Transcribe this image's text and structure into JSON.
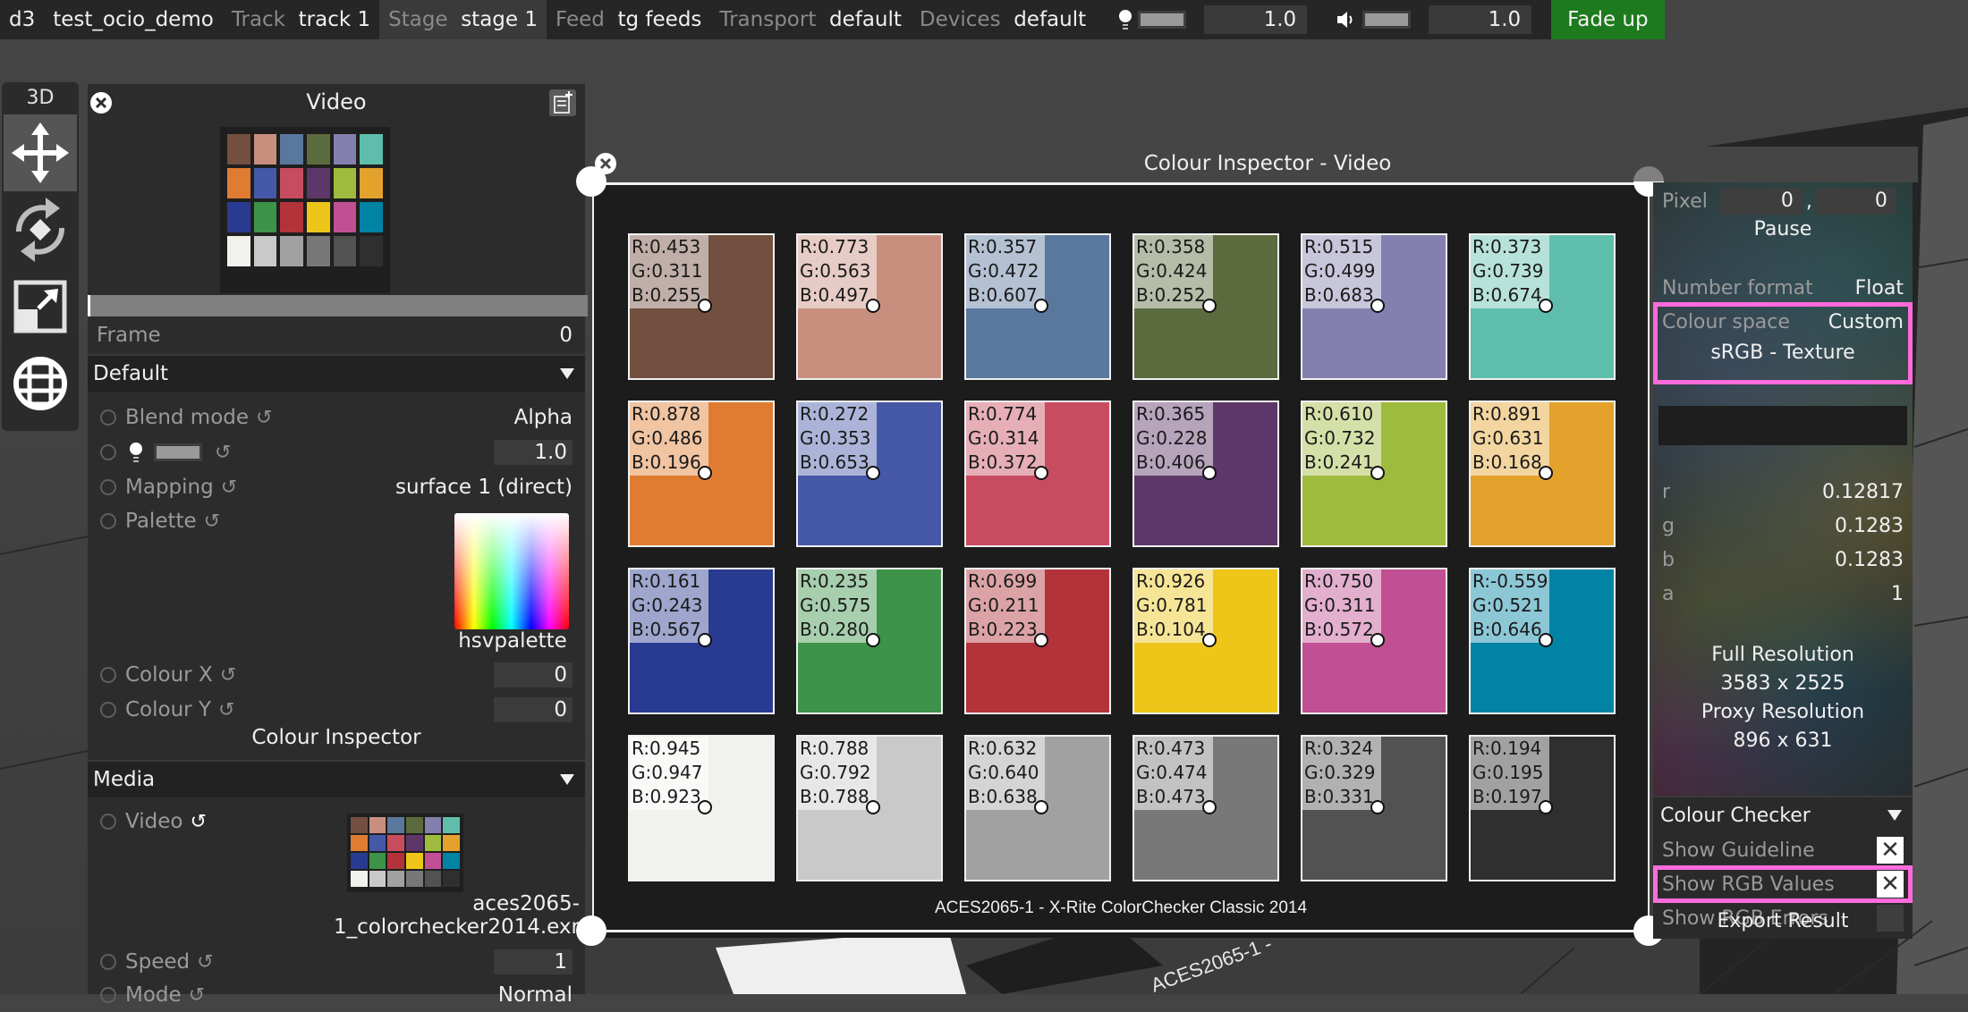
{
  "topbar": {
    "app": "d3",
    "project": "test_ocio_demo",
    "track_label": "Track",
    "track_value": "track 1",
    "stage_label": "Stage",
    "stage_value": "stage 1",
    "feed_label": "Feed",
    "feed_value": "tg feeds",
    "transport_label": "Transport",
    "transport_value": "default",
    "devices_label": "Devices",
    "devices_value": "default",
    "brightness_icon": "lightbulb-icon",
    "brightness_value": "1.0",
    "volume_icon": "speaker-icon",
    "volume_value": "1.0",
    "fade_button": "Fade up",
    "fade_color": "#1e7a1e"
  },
  "toolstrip": {
    "mode": "3D",
    "tools": [
      {
        "name": "move",
        "icon": "move-arrows-icon",
        "active": true
      },
      {
        "name": "rotate",
        "icon": "rotate-icon",
        "active": false
      },
      {
        "name": "scale",
        "icon": "scale-icon",
        "active": false
      },
      {
        "name": "global",
        "icon": "globe-icon",
        "active": false
      }
    ]
  },
  "left_panel": {
    "title": "Video",
    "frame_label": "Frame",
    "frame_value": "0",
    "default_section": "Default",
    "blend_mode_label": "Blend mode",
    "blend_mode_value": "Alpha",
    "brightness_value": "1.0",
    "mapping_label": "Mapping",
    "mapping_value": "surface 1 (direct)",
    "palette_label": "Palette",
    "palette_value": "hsvpalette",
    "colour_x_label": "Colour X",
    "colour_x_value": "0",
    "colour_y_label": "Colour Y",
    "colour_y_value": "0",
    "colour_inspector_button": "Colour Inspector",
    "media_section": "Media",
    "video_label": "Video",
    "video_file": "aces2065-1_colorchecker2014.exr",
    "speed_label": "Speed",
    "speed_value": "1",
    "mode_label": "Mode",
    "mode_value": "Normal"
  },
  "inspector": {
    "title": "Colour Inspector - Video",
    "caption": "ACES2065-1 - X-Rite ColorChecker Classic 2014",
    "patches": [
      {
        "color": "#734f40",
        "r": "R:0.453",
        "g": "G:0.311",
        "b": "B:0.255"
      },
      {
        "color": "#c88f7f",
        "r": "R:0.773",
        "g": "G:0.563",
        "b": "B:0.497"
      },
      {
        "color": "#5a779d",
        "r": "R:0.357",
        "g": "G:0.472",
        "b": "B:0.607"
      },
      {
        "color": "#5b6b3d",
        "r": "R:0.358",
        "g": "G:0.424",
        "b": "B:0.252"
      },
      {
        "color": "#8380b0",
        "r": "R:0.515",
        "g": "G:0.499",
        "b": "B:0.683"
      },
      {
        "color": "#5fbeab",
        "r": "R:0.373",
        "g": "G:0.739",
        "b": "B:0.674"
      },
      {
        "color": "#e07c32",
        "r": "R:0.878",
        "g": "G:0.486",
        "b": "B:0.196"
      },
      {
        "color": "#4559a8",
        "r": "R:0.272",
        "g": "G:0.353",
        "b": "B:0.653"
      },
      {
        "color": "#c84c5f",
        "r": "R:0.774",
        "g": "G:0.314",
        "b": "B:0.372"
      },
      {
        "color": "#5d3769",
        "r": "R:0.365",
        "g": "G:0.228",
        "b": "B:0.406"
      },
      {
        "color": "#9fbb3e",
        "r": "R:0.610",
        "g": "G:0.732",
        "b": "B:0.241"
      },
      {
        "color": "#e4a22d",
        "r": "R:0.891",
        "g": "G:0.631",
        "b": "B:0.168"
      },
      {
        "color": "#283b91",
        "r": "R:0.161",
        "g": "G:0.243",
        "b": "B:0.567"
      },
      {
        "color": "#3c9349",
        "r": "R:0.235",
        "g": "G:0.575",
        "b": "B:0.280"
      },
      {
        "color": "#b2333a",
        "r": "R:0.699",
        "g": "G:0.211",
        "b": "B:0.223"
      },
      {
        "color": "#edc619",
        "r": "R:0.926",
        "g": "G:0.781",
        "b": "B:0.104"
      },
      {
        "color": "#c14f93",
        "r": "R:0.750",
        "g": "G:0.311",
        "b": "B:0.572"
      },
      {
        "color": "#0083a4",
        "r": "R:-0.559",
        "g": "G:0.521",
        "b": "B:0.646"
      },
      {
        "color": "#f1f1ee",
        "r": "R:0.945",
        "g": "G:0.947",
        "b": "B:0.923"
      },
      {
        "color": "#c9c9c9",
        "r": "R:0.788",
        "g": "G:0.792",
        "b": "B:0.788"
      },
      {
        "color": "#a1a1a1",
        "r": "R:0.632",
        "g": "G:0.640",
        "b": "B:0.638"
      },
      {
        "color": "#787878",
        "r": "R:0.473",
        "g": "G:0.474",
        "b": "B:0.473"
      },
      {
        "color": "#525252",
        "r": "R:0.324",
        "g": "G:0.329",
        "b": "B:0.331"
      },
      {
        "color": "#2f2f2f",
        "r": "R:0.194",
        "g": "G:0.195",
        "b": "B:0.197"
      }
    ],
    "pixel_label": "Pixel",
    "pixel_x": "0",
    "pixel_sep": ",",
    "pixel_y": "0",
    "pause_button": "Pause",
    "number_format_label": "Number format",
    "number_format_value": "Float",
    "colour_space_label": "Colour space",
    "colour_space_value": "Custom",
    "colour_space_name": "sRGB - Texture",
    "r_label": "r",
    "r_value": "0.12817",
    "g_label": "g",
    "g_value": "0.1283",
    "b_label": "b",
    "b_value": "0.1283",
    "a_label": "a",
    "a_value": "1",
    "full_res_label": "Full Resolution",
    "full_res_value": "3583 x 2525",
    "proxy_res_label": "Proxy Resolution",
    "proxy_res_value": "896 x 631",
    "checker_section": "Colour Checker",
    "show_guideline_label": "Show Guideline",
    "show_guideline": true,
    "show_rgb_values_label": "Show RGB Values",
    "show_rgb_values": true,
    "show_rgb_errors_label": "Show RGB Errors",
    "show_rgb_errors": false,
    "export_button": "Export Result",
    "check_mark": "✕",
    "highlight_color": "#ff6bdc"
  },
  "viewport": {
    "floor_label": "ACES2065-1 -"
  }
}
